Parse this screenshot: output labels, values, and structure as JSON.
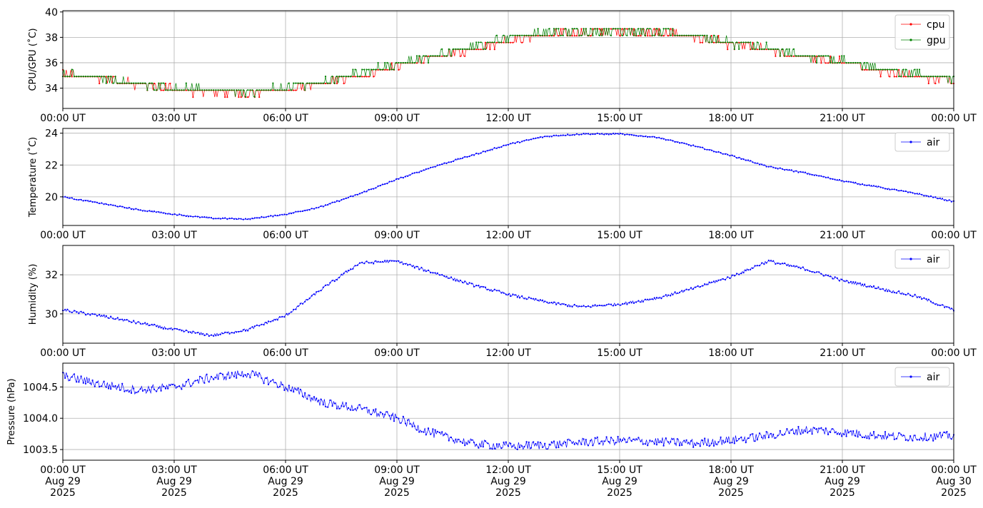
{
  "chart_data": [
    {
      "type": "line",
      "ylabel": "CPU/GPU (˚C)",
      "x_range": [
        "2025-08-29T00:00:00Z",
        "2025-08-30T00:00:00Z"
      ],
      "ylim": [
        32.4,
        40.1
      ],
      "yticks": [
        34,
        36,
        38,
        40
      ],
      "grid": true,
      "legend": "top-right",
      "series": [
        {
          "name": "cpu",
          "color": "#ff0000",
          "x": [
            "2025-08-29T00:00:00Z",
            "2025-08-29T01:00:00Z",
            "2025-08-29T02:00:00Z",
            "2025-08-29T03:00:00Z",
            "2025-08-29T04:00:00Z",
            "2025-08-29T05:00:00Z",
            "2025-08-29T06:00:00Z",
            "2025-08-29T07:00:00Z",
            "2025-08-29T08:00:00Z",
            "2025-08-29T09:00:00Z",
            "2025-08-29T10:00:00Z",
            "2025-08-29T11:00:00Z",
            "2025-08-29T12:00:00Z",
            "2025-08-29T13:00:00Z",
            "2025-08-29T14:00:00Z",
            "2025-08-29T15:00:00Z",
            "2025-08-29T16:00:00Z",
            "2025-08-29T17:00:00Z",
            "2025-08-29T18:00:00Z",
            "2025-08-29T19:00:00Z",
            "2025-08-29T20:00:00Z",
            "2025-08-29T21:00:00Z",
            "2025-08-29T22:00:00Z",
            "2025-08-29T23:00:00Z",
            "2025-08-30T00:00:00Z"
          ],
          "values": [
            35.1,
            34.8,
            34.3,
            33.9,
            33.7,
            33.6,
            33.9,
            34.4,
            35.0,
            35.7,
            36.4,
            37.0,
            37.8,
            38.2,
            38.4,
            38.5,
            38.4,
            38.1,
            37.5,
            37.0,
            36.4,
            36.0,
            35.4,
            34.9,
            34.6
          ]
        },
        {
          "name": "gpu",
          "color": "#008000",
          "x": [
            "2025-08-29T00:00:00Z",
            "2025-08-29T01:00:00Z",
            "2025-08-29T02:00:00Z",
            "2025-08-29T03:00:00Z",
            "2025-08-29T04:00:00Z",
            "2025-08-29T05:00:00Z",
            "2025-08-29T06:00:00Z",
            "2025-08-29T07:00:00Z",
            "2025-08-29T08:00:00Z",
            "2025-08-29T09:00:00Z",
            "2025-08-29T10:00:00Z",
            "2025-08-29T11:00:00Z",
            "2025-08-29T12:00:00Z",
            "2025-08-29T13:00:00Z",
            "2025-08-29T14:00:00Z",
            "2025-08-29T15:00:00Z",
            "2025-08-29T16:00:00Z",
            "2025-08-29T17:00:00Z",
            "2025-08-29T18:00:00Z",
            "2025-08-29T19:00:00Z",
            "2025-08-29T20:00:00Z",
            "2025-08-29T21:00:00Z",
            "2025-08-29T22:00:00Z",
            "2025-08-29T23:00:00Z",
            "2025-08-30T00:00:00Z"
          ],
          "values": [
            35.2,
            34.8,
            34.3,
            34.0,
            33.8,
            33.7,
            34.0,
            34.5,
            35.2,
            35.9,
            36.5,
            37.2,
            38.0,
            38.3,
            38.5,
            38.5,
            38.4,
            38.2,
            37.6,
            37.1,
            36.5,
            36.1,
            35.6,
            35.1,
            34.8
          ]
        }
      ]
    },
    {
      "type": "line",
      "ylabel": "Temperature (˚C)",
      "x_range": [
        "2025-08-29T00:00:00Z",
        "2025-08-30T00:00:00Z"
      ],
      "ylim": [
        18.2,
        24.3
      ],
      "yticks": [
        20,
        22,
        24
      ],
      "grid": true,
      "legend": "top-right",
      "series": [
        {
          "name": "air",
          "color": "#0000ff",
          "x": [
            "2025-08-29T00:00:00Z",
            "2025-08-29T01:00:00Z",
            "2025-08-29T02:00:00Z",
            "2025-08-29T03:00:00Z",
            "2025-08-29T04:00:00Z",
            "2025-08-29T05:00:00Z",
            "2025-08-29T06:00:00Z",
            "2025-08-29T07:00:00Z",
            "2025-08-29T08:00:00Z",
            "2025-08-29T09:00:00Z",
            "2025-08-29T10:00:00Z",
            "2025-08-29T11:00:00Z",
            "2025-08-29T12:00:00Z",
            "2025-08-29T13:00:00Z",
            "2025-08-29T14:00:00Z",
            "2025-08-29T15:00:00Z",
            "2025-08-29T16:00:00Z",
            "2025-08-29T17:00:00Z",
            "2025-08-29T18:00:00Z",
            "2025-08-29T19:00:00Z",
            "2025-08-29T20:00:00Z",
            "2025-08-29T21:00:00Z",
            "2025-08-29T22:00:00Z",
            "2025-08-29T23:00:00Z",
            "2025-08-30T00:00:00Z"
          ],
          "values": [
            20.0,
            19.6,
            19.2,
            18.9,
            18.65,
            18.6,
            18.9,
            19.4,
            20.2,
            21.1,
            21.9,
            22.6,
            23.3,
            23.8,
            23.95,
            23.95,
            23.75,
            23.2,
            22.6,
            21.9,
            21.5,
            21.0,
            20.6,
            20.2,
            19.7
          ]
        }
      ]
    },
    {
      "type": "line",
      "ylabel": "Humidity (%)",
      "x_range": [
        "2025-08-29T00:00:00Z",
        "2025-08-30T00:00:00Z"
      ],
      "ylim": [
        28.5,
        33.5
      ],
      "yticks": [
        30,
        32
      ],
      "grid": true,
      "legend": "top-right",
      "series": [
        {
          "name": "air",
          "color": "#0000ff",
          "x": [
            "2025-08-29T00:00:00Z",
            "2025-08-29T01:00:00Z",
            "2025-08-29T02:00:00Z",
            "2025-08-29T03:00:00Z",
            "2025-08-29T04:00:00Z",
            "2025-08-29T05:00:00Z",
            "2025-08-29T06:00:00Z",
            "2025-08-29T07:00:00Z",
            "2025-08-29T08:00:00Z",
            "2025-08-29T09:00:00Z",
            "2025-08-29T10:00:00Z",
            "2025-08-29T11:00:00Z",
            "2025-08-29T12:00:00Z",
            "2025-08-29T13:00:00Z",
            "2025-08-29T14:00:00Z",
            "2025-08-29T15:00:00Z",
            "2025-08-29T16:00:00Z",
            "2025-08-29T17:00:00Z",
            "2025-08-29T18:00:00Z",
            "2025-08-29T19:00:00Z",
            "2025-08-29T20:00:00Z",
            "2025-08-29T21:00:00Z",
            "2025-08-29T22:00:00Z",
            "2025-08-29T23:00:00Z",
            "2025-08-30T00:00:00Z"
          ],
          "values": [
            30.2,
            29.9,
            29.55,
            29.2,
            28.9,
            29.2,
            29.9,
            31.3,
            32.6,
            32.7,
            32.1,
            31.5,
            31.0,
            30.6,
            30.35,
            30.5,
            30.8,
            31.3,
            31.9,
            32.7,
            32.3,
            31.7,
            31.3,
            30.9,
            30.2
          ]
        }
      ]
    },
    {
      "type": "line",
      "ylabel": "Pressure (hPa)",
      "x_range": [
        "2025-08-29T00:00:00Z",
        "2025-08-30T00:00:00Z"
      ],
      "ylim": [
        1003.33,
        1004.88
      ],
      "yticks": [
        1003.5,
        1004.0,
        1004.5
      ],
      "ytick_labels": [
        "1003.5",
        "1004.0",
        "1004.5"
      ],
      "grid": true,
      "legend": "top-right",
      "series": [
        {
          "name": "air",
          "color": "#0000ff",
          "x": [
            "2025-08-29T00:00:00Z",
            "2025-08-29T01:00:00Z",
            "2025-08-29T02:00:00Z",
            "2025-08-29T03:00:00Z",
            "2025-08-29T04:00:00Z",
            "2025-08-29T05:00:00Z",
            "2025-08-29T06:00:00Z",
            "2025-08-29T07:00:00Z",
            "2025-08-29T08:00:00Z",
            "2025-08-29T09:00:00Z",
            "2025-08-29T10:00:00Z",
            "2025-08-29T11:00:00Z",
            "2025-08-29T12:00:00Z",
            "2025-08-29T13:00:00Z",
            "2025-08-29T14:00:00Z",
            "2025-08-29T15:00:00Z",
            "2025-08-29T16:00:00Z",
            "2025-08-29T17:00:00Z",
            "2025-08-29T18:00:00Z",
            "2025-08-29T19:00:00Z",
            "2025-08-29T20:00:00Z",
            "2025-08-29T21:00:00Z",
            "2025-08-29T22:00:00Z",
            "2025-08-29T23:00:00Z",
            "2025-08-30T00:00:00Z"
          ],
          "values": [
            1004.68,
            1004.55,
            1004.45,
            1004.5,
            1004.65,
            1004.72,
            1004.5,
            1004.25,
            1004.15,
            1004.0,
            1003.75,
            1003.6,
            1003.55,
            1003.57,
            1003.62,
            1003.64,
            1003.63,
            1003.6,
            1003.65,
            1003.72,
            1003.82,
            1003.78,
            1003.72,
            1003.7,
            1003.72
          ]
        }
      ]
    }
  ],
  "x_tick_labels": [
    "00:00 UT",
    "03:00 UT",
    "06:00 UT",
    "09:00 UT",
    "12:00 UT",
    "15:00 UT",
    "18:00 UT",
    "21:00 UT",
    "00:00 UT"
  ],
  "x_tick_dates": [
    "Aug 29",
    "Aug 29",
    "Aug 29",
    "Aug 29",
    "Aug 29",
    "Aug 29",
    "Aug 29",
    "Aug 29",
    "Aug 30"
  ],
  "x_tick_years": [
    "2025",
    "2025",
    "2025",
    "2025",
    "2025",
    "2025",
    "2025",
    "2025",
    "2025"
  ],
  "grid_color": "#b0b0b0"
}
